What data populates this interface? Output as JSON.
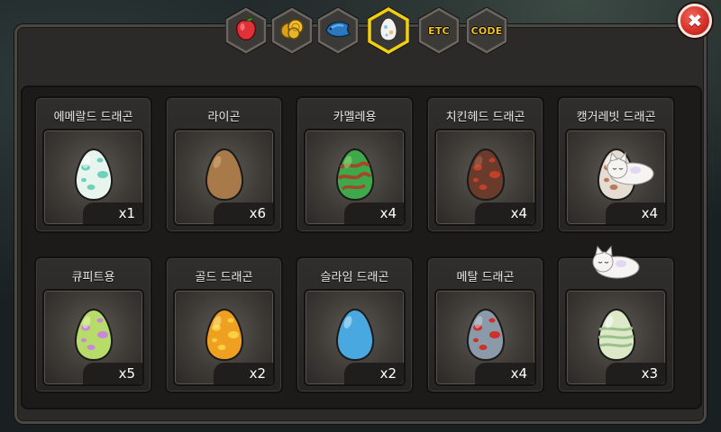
{
  "tabs": [
    {
      "id": "fruit",
      "kind": "icon",
      "icon": "red-fruit-icon",
      "selected": false
    },
    {
      "id": "gold",
      "kind": "icon",
      "icon": "gold-coins-icon",
      "selected": false
    },
    {
      "id": "fish",
      "kind": "icon",
      "icon": "blue-fish-icon",
      "selected": false
    },
    {
      "id": "egg",
      "kind": "icon",
      "icon": "egg-icon",
      "selected": true
    },
    {
      "id": "etc",
      "kind": "text",
      "label": "ETC",
      "selected": false
    },
    {
      "id": "code",
      "kind": "text",
      "label": "CODE",
      "selected": false
    }
  ],
  "close_label": "✖",
  "eggs": [
    {
      "name": "에메랄드 드래곤",
      "count": "x1",
      "colors": {
        "base": "#e8f4ee",
        "spot": "#6fd1b8",
        "hi": "#ffffff"
      },
      "pattern": "spots"
    },
    {
      "name": "라이곤",
      "count": "x6",
      "colors": {
        "base": "#a87a4a",
        "spot": "#7a5430",
        "hi": "#d8b080"
      },
      "pattern": "plain"
    },
    {
      "name": "카멜레용",
      "count": "x4",
      "colors": {
        "base": "#3fa84a",
        "spot": "#a04a2a",
        "hi": "#8fe07a"
      },
      "pattern": "stripes"
    },
    {
      "name": "치킨헤드 드래곤",
      "count": "x4",
      "colors": {
        "base": "#6a3a2a",
        "spot": "#c0402a",
        "hi": "#a86a50"
      },
      "pattern": "spots"
    },
    {
      "name": "캥거레빗 드래곤",
      "count": "x4",
      "colors": {
        "base": "#e6ddd2",
        "spot": "#b87a5a",
        "hi": "#ffffff"
      },
      "pattern": "spots",
      "cat": true
    },
    {
      "name": "큐피트용",
      "count": "x5",
      "colors": {
        "base": "#b8dc6a",
        "spot": "#c88ad8",
        "hi": "#e8f8b0"
      },
      "pattern": "spots"
    },
    {
      "name": "골드 드래곤",
      "count": "x2",
      "colors": {
        "base": "#f0a020",
        "spot": "#f8d040",
        "hi": "#ffe890"
      },
      "pattern": "spots"
    },
    {
      "name": "슬라임 드래곤",
      "count": "x2",
      "colors": {
        "base": "#4aa8e0",
        "spot": "#8ad0f8",
        "hi": "#c8ecff"
      },
      "pattern": "plain"
    },
    {
      "name": "메탈 드래곤",
      "count": "x4",
      "colors": {
        "base": "#8a9aa8",
        "spot": "#d0302a",
        "hi": "#c8d4de"
      },
      "pattern": "spots"
    },
    {
      "name": "",
      "count": "x3",
      "colors": {
        "base": "#dce8c8",
        "spot": "#9ac08a",
        "hi": "#ffffff"
      },
      "pattern": "bands",
      "cat": true
    }
  ]
}
